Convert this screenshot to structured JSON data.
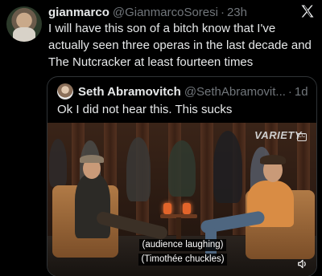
{
  "tweet": {
    "display_name": "gianmarco",
    "handle": "@GianmarcoSoresi",
    "separator": "·",
    "time": "23h",
    "text": "I will have this son of a bitch know that I've actually seen three operas in the last decade and The Nutcracker at least fourteen times"
  },
  "quote": {
    "display_name": "Seth Abramovitch",
    "handle": "@SethAbramovit...",
    "separator": "·",
    "time": "1d",
    "text": "Ok I did not hear this. This sucks"
  },
  "video": {
    "watermark": "VARIETY",
    "subtitle_line1": "(audience laughing)",
    "subtitle_line2": "(Timothée chuckles)"
  },
  "icons": {
    "logo": "x-logo-icon",
    "captions": "captions-icon",
    "sound": "speaker-icon"
  },
  "colors": {
    "background": "#000000",
    "text_primary": "#e7e9ea",
    "text_secondary": "#71767b",
    "border": "#2f3336"
  }
}
